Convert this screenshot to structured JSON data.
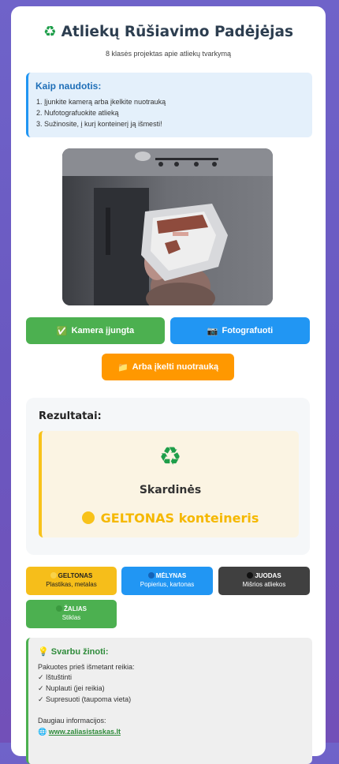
{
  "header": {
    "icon": "recycle-icon",
    "title": "Atliekų Rūšiavimo Padėjėjas",
    "subtitle": "8 klasės projektas apie atliekų tvarkymą"
  },
  "howto": {
    "title": "Kaip naudotis:",
    "steps": [
      "1. Įjunkite kamerą arba įkelkite nuotrauką",
      "2. Nufotografuokite atlieką",
      "3. Sužinosite, į kurį konteinerį ją išmesti!"
    ]
  },
  "buttons": {
    "camera": {
      "icon": "check-icon",
      "label": "Kamera įjungta"
    },
    "photo": {
      "icon": "camera-icon",
      "label": "Fotografuoti"
    },
    "upload": {
      "icon": "folder-icon",
      "label": "Arba įkelti nuotrauką"
    }
  },
  "results": {
    "title": "Rezultatai:",
    "icon": "recycle-icon",
    "item": "Skardinės",
    "container": "GELTONAS konteineris",
    "container_color": "#f8c21a"
  },
  "bins": [
    {
      "name": "GELTONAS",
      "sub": "Plastikas, metalas",
      "color": "#f6be1a"
    },
    {
      "name": "MĖLYNAS",
      "sub": "Popierius, kartonas",
      "color": "#2196f3"
    },
    {
      "name": "JUODAS",
      "sub": "Mišrios atliekos",
      "color": "#404040"
    },
    {
      "name": "ŽALIAS",
      "sub": "Stiklas",
      "color": "#4cb050"
    }
  ],
  "info": {
    "icon": "lightbulb-icon",
    "title": "Svarbu žinoti:",
    "intro": "Pakuotes prieš išmetant reikia:",
    "checks": [
      "✓ Ištuštinti",
      "✓ Nuplauti (jei reikia)",
      "✓ Supresuoti (taupoma vieta)"
    ],
    "more": "Daugiau informacijos:",
    "link": "www.zaliasistaskas.lt"
  }
}
